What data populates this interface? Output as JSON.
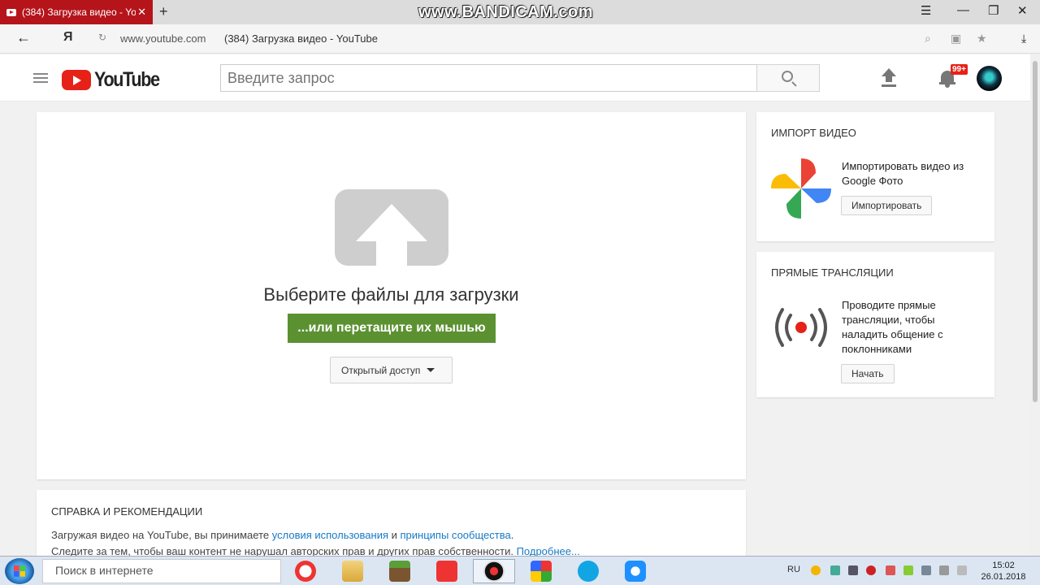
{
  "browser": {
    "tab_title": "(384) Загрузка видео - YouTube",
    "new_tab": "+",
    "watermark": "www.BANDICAM.com",
    "url": "www.youtube.com",
    "page_title": "(384) Загрузка видео - YouTube",
    "yandex_letter": "Я"
  },
  "header": {
    "logo_text": "YouTube",
    "search_placeholder": "Введите запрос",
    "notif_badge": "99+"
  },
  "upload": {
    "select_title": "Выберите файлы для загрузки",
    "drag_label": "...или перетащите их мышью",
    "privacy_label": "Открытый доступ"
  },
  "import": {
    "title": "ИМПОРТ ВИДЕО",
    "text": "Импортировать видео из Google Фото",
    "button": "Импортировать"
  },
  "live": {
    "title": "ПРЯМЫЕ ТРАНСЛЯЦИИ",
    "text": "Проводите прямые трансляции, чтобы наладить общение с поклонниками",
    "button": "Начать"
  },
  "help": {
    "title": "СПРАВКА И РЕКОМЕНДАЦИИ",
    "line1_a": "Загружая видео на YouTube, вы принимаете ",
    "terms_link": "условия использования",
    "line1_b": " и ",
    "guidelines_link": "принципы сообщества",
    "line1_c": ".",
    "line2": "Следите за тем, чтобы ваш контент не нарушал авторских прав и других прав собственности. ",
    "more_link": "Подробнее..."
  },
  "taskbar": {
    "search": "Поиск в интернете",
    "lang": "RU",
    "time": "15:02",
    "date": "26.01.2018"
  }
}
